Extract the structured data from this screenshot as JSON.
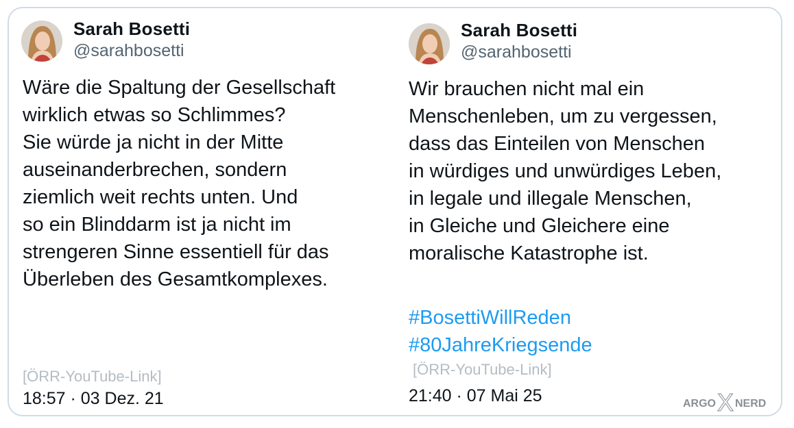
{
  "tweets": [
    {
      "author": {
        "name": "Sarah Bosetti",
        "handle": "@sarahbosetti"
      },
      "lines": [
        "Wäre die Spaltung der Gesellschaft",
        "wirklich etwas so Schlimmes?",
        "Sie würde ja nicht in der Mitte",
        "auseinanderbrechen, sondern",
        "ziemlich weit rechts unten. Und",
        "so ein Blinddarm ist ja nicht im",
        "strengeren Sinne essentiell für das",
        "Überleben des Gesamtkomplexes."
      ],
      "link_text": "[ÖRR-YouTube-Link]",
      "timestamp": "18:57 · 03 Dez. 21"
    },
    {
      "author": {
        "name": "Sarah Bosetti",
        "handle": "@sarahbosetti"
      },
      "lines": [
        "Wir brauchen nicht mal ein",
        "Menschenleben, um zu vergessen,",
        "dass das Einteilen von Menschen",
        "in würdiges und unwürdiges Leben,",
        "in legale und illegale Menschen,",
        "in Gleiche und Gleichere eine",
        "moralische Katastrophe ist."
      ],
      "hashtags": [
        "#BosettiWillReden",
        "#80JahreKriegsende"
      ],
      "link_text": "[ÖRR-YouTube-Link]",
      "timestamp": "21:40 · 07 Mai 25"
    }
  ],
  "watermark": {
    "left": "ARGO",
    "mid": "X",
    "right": "NERD"
  },
  "colors": {
    "text": "#0f1419",
    "handle": "#536471",
    "hashtag": "#1d9bf0",
    "link_placeholder": "#b4bcc3",
    "border": "#cfdbe6"
  }
}
